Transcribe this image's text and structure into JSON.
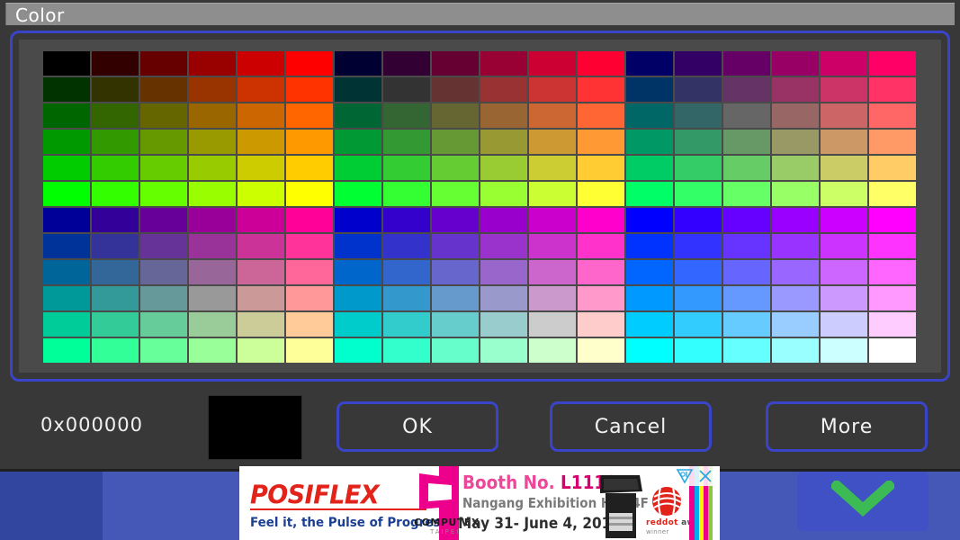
{
  "dialog": {
    "title": "Color",
    "hex_value": "0x000000",
    "preview_color": "#000000",
    "accent_border": "#3a44c8",
    "surface": "#383838",
    "titlebar": "#8e8e8e",
    "buttons": [
      {
        "id": "ok",
        "label": "OK"
      },
      {
        "id": "cancel",
        "label": "Cancel"
      },
      {
        "id": "more",
        "label": "More"
      }
    ]
  },
  "palette": {
    "columns": 18,
    "rows": 12,
    "swatches": [
      [
        "#000000",
        "#330000",
        "#660000",
        "#990000",
        "#cc0000",
        "#ff0000",
        "#000033",
        "#330033",
        "#660033",
        "#990033",
        "#cc0033",
        "#ff0033",
        "#000066",
        "#330066",
        "#660066",
        "#990066",
        "#cc0066",
        "#ff0066"
      ],
      [
        "#003300",
        "#333300",
        "#663300",
        "#993300",
        "#cc3300",
        "#ff3300",
        "#003333",
        "#333333",
        "#663333",
        "#993333",
        "#cc3333",
        "#ff3333",
        "#003366",
        "#333366",
        "#663366",
        "#993366",
        "#cc3366",
        "#ff3366"
      ],
      [
        "#006600",
        "#336600",
        "#666600",
        "#996600",
        "#cc6600",
        "#ff6600",
        "#006633",
        "#336633",
        "#666633",
        "#996633",
        "#cc6633",
        "#ff6633",
        "#006666",
        "#336666",
        "#666666",
        "#996666",
        "#cc6666",
        "#ff6666"
      ],
      [
        "#009900",
        "#339900",
        "#669900",
        "#999900",
        "#cc9900",
        "#ff9900",
        "#009933",
        "#339933",
        "#669933",
        "#999933",
        "#cc9933",
        "#ff9933",
        "#009966",
        "#339966",
        "#669966",
        "#999966",
        "#cc9966",
        "#ff9966"
      ],
      [
        "#00cc00",
        "#33cc00",
        "#66cc00",
        "#99cc00",
        "#cccc00",
        "#ffcc00",
        "#00cc33",
        "#33cc33",
        "#66cc33",
        "#99cc33",
        "#cccc33",
        "#ffcc33",
        "#00cc66",
        "#33cc66",
        "#66cc66",
        "#99cc66",
        "#cccc66",
        "#ffcc66"
      ],
      [
        "#00ff00",
        "#33ff00",
        "#66ff00",
        "#99ff00",
        "#ccff00",
        "#ffff00",
        "#00ff33",
        "#33ff33",
        "#66ff33",
        "#99ff33",
        "#ccff33",
        "#ffff33",
        "#00ff66",
        "#33ff66",
        "#66ff66",
        "#99ff66",
        "#ccff66",
        "#ffff66"
      ],
      [
        "#000099",
        "#330099",
        "#660099",
        "#990099",
        "#cc0099",
        "#ff0099",
        "#0000cc",
        "#3300cc",
        "#6600cc",
        "#9900cc",
        "#cc00cc",
        "#ff00cc",
        "#0000ff",
        "#3300ff",
        "#6600ff",
        "#9900ff",
        "#cc00ff",
        "#ff00ff"
      ],
      [
        "#003399",
        "#333399",
        "#663399",
        "#993399",
        "#cc3399",
        "#ff3399",
        "#0033cc",
        "#3333cc",
        "#6633cc",
        "#9933cc",
        "#cc33cc",
        "#ff33cc",
        "#0033ff",
        "#3333ff",
        "#6633ff",
        "#9933ff",
        "#cc33ff",
        "#ff33ff"
      ],
      [
        "#006699",
        "#336699",
        "#666699",
        "#996699",
        "#cc6699",
        "#ff6699",
        "#0066cc",
        "#3366cc",
        "#6666cc",
        "#9966cc",
        "#cc66cc",
        "#ff66cc",
        "#0066ff",
        "#3366ff",
        "#6666ff",
        "#9966ff",
        "#cc66ff",
        "#ff66ff"
      ],
      [
        "#009999",
        "#339999",
        "#669999",
        "#999999",
        "#cc9999",
        "#ff9999",
        "#0099cc",
        "#3399cc",
        "#6699cc",
        "#9999cc",
        "#cc99cc",
        "#ff99cc",
        "#0099ff",
        "#3399ff",
        "#6699ff",
        "#9999ff",
        "#cc99ff",
        "#ff99ff"
      ],
      [
        "#00cc99",
        "#33cc99",
        "#66cc99",
        "#99cc99",
        "#cccc99",
        "#ffcc99",
        "#00cccc",
        "#33cccc",
        "#66cccc",
        "#99cccc",
        "#cccccc",
        "#ffcccc",
        "#00ccff",
        "#33ccff",
        "#66ccff",
        "#99ccff",
        "#ccccff",
        "#ffccff"
      ],
      [
        "#00ff99",
        "#33ff99",
        "#66ff99",
        "#99ff99",
        "#ccff99",
        "#ffff99",
        "#00ffcc",
        "#33ffcc",
        "#66ffcc",
        "#99ffcc",
        "#ccffcc",
        "#ffffcc",
        "#00ffff",
        "#33ffff",
        "#66ffff",
        "#99ffff",
        "#ccffff",
        "#ffffff"
      ]
    ]
  },
  "ad": {
    "brand": "POSIFLEX",
    "tagline": "Feel it, the Pulse of Progress.",
    "expo_name": "COMPUTEX",
    "expo_sub": "TAIPEI",
    "booth_prefix": "Booth No. ",
    "booth_number": "L1112",
    "hall": "Nangang Exhibition Hall 4F",
    "dates": "May 31- June 4, 2016",
    "award_red": "reddot",
    "award_rest": " award 2016",
    "award_sub": "winner",
    "adchoices_icon": "adchoices-icon",
    "close_icon": "close-icon"
  },
  "app": {
    "collapse_icon": "chevron-down-icon",
    "collapse_color": "#3cba54",
    "background": "#4557b7"
  }
}
